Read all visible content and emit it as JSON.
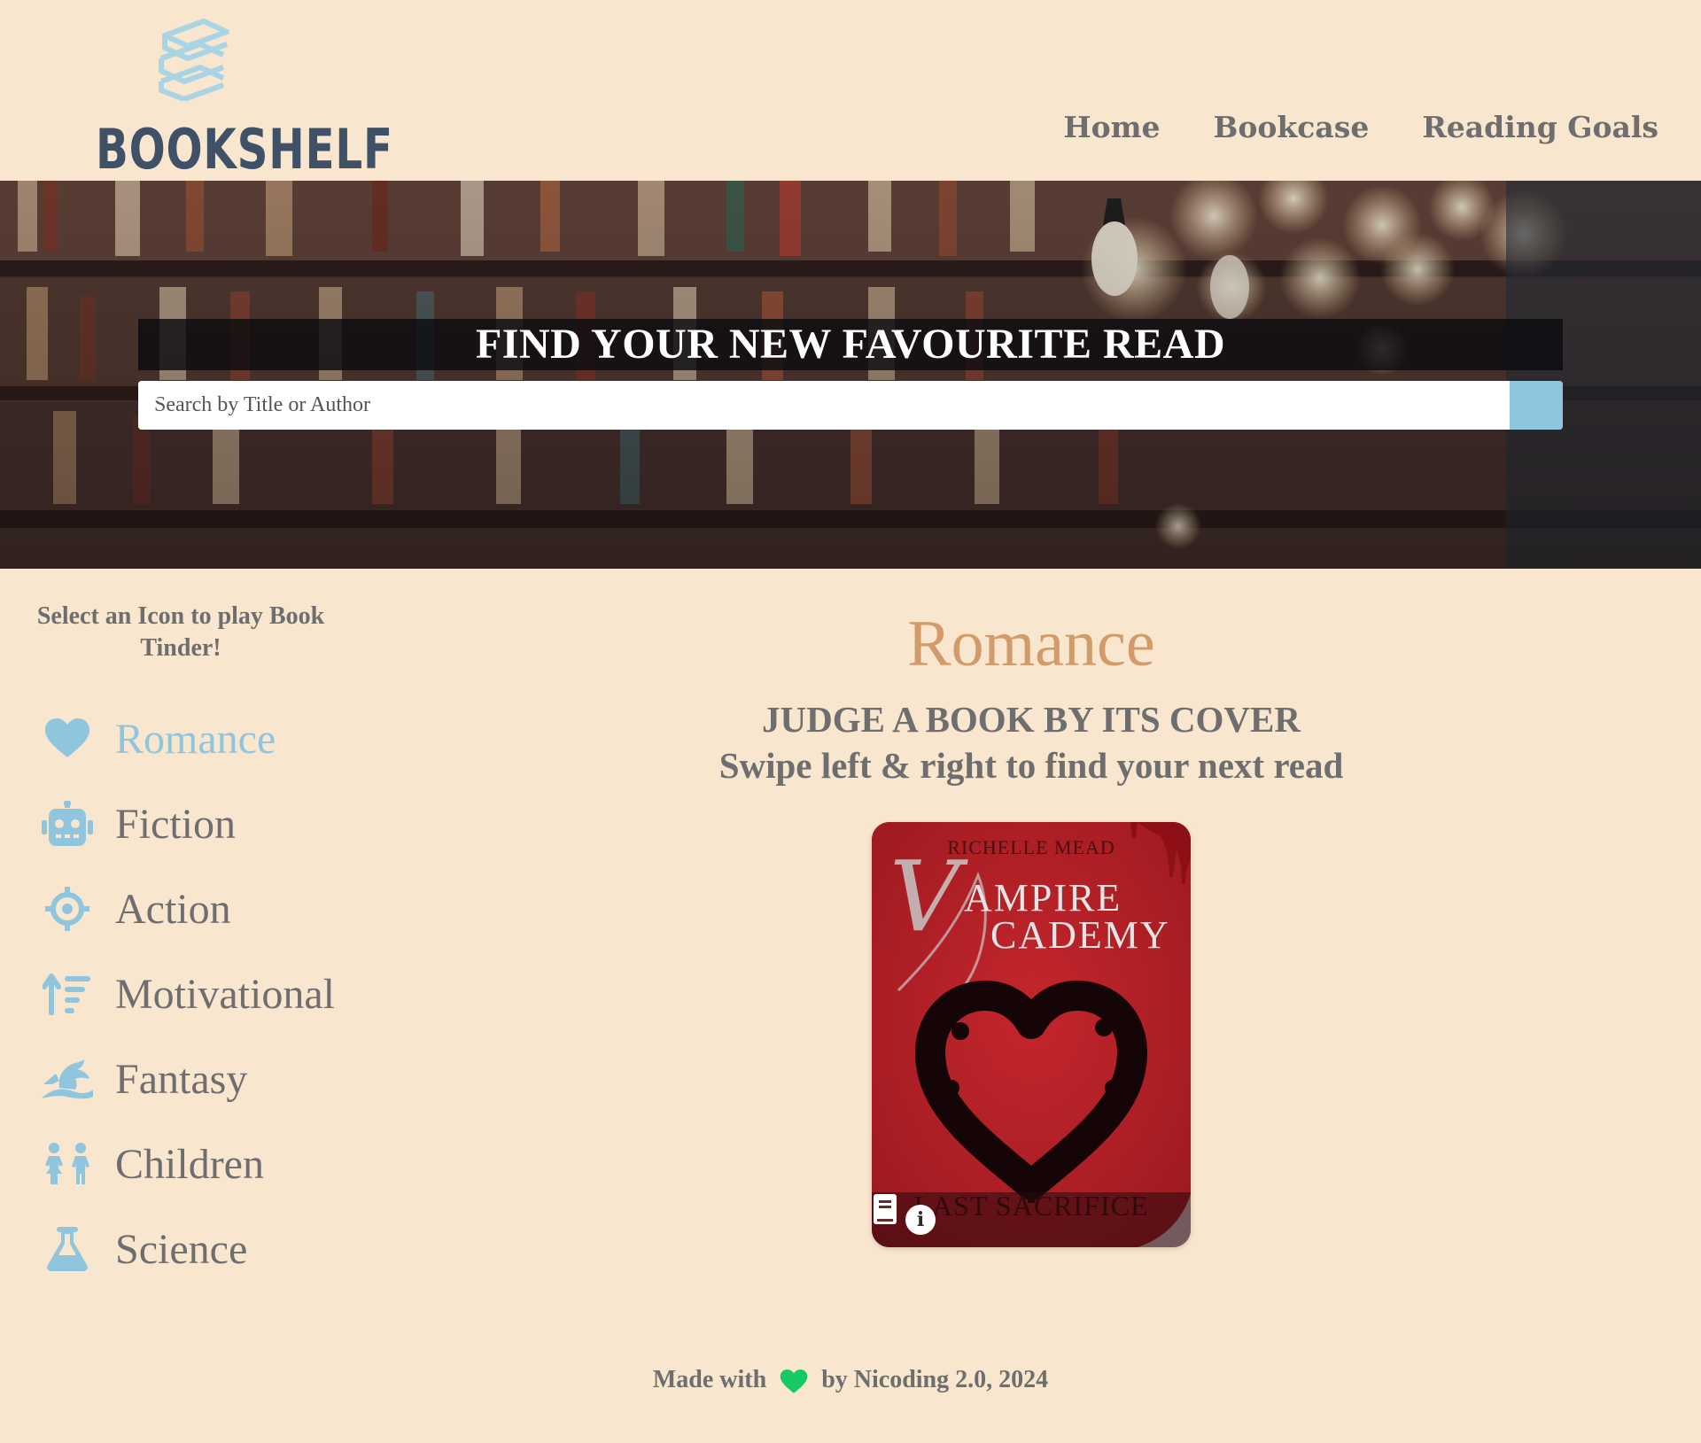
{
  "brand": {
    "name": "BOOKSHELF"
  },
  "nav": {
    "items": [
      {
        "label": "Home"
      },
      {
        "label": "Bookcase"
      },
      {
        "label": "Reading Goals"
      }
    ]
  },
  "hero": {
    "title": "FIND YOUR NEW FAVOURITE READ",
    "search_placeholder": "Search by Title or Author",
    "search_value": ""
  },
  "sidebar": {
    "heading": "Select an Icon to play Book Tinder!",
    "categories": [
      {
        "label": "Romance",
        "icon": "heart-icon",
        "active": true
      },
      {
        "label": "Fiction",
        "icon": "robot-icon",
        "active": false
      },
      {
        "label": "Action",
        "icon": "crosshair-icon",
        "active": false
      },
      {
        "label": "Motivational",
        "icon": "sort-up-icon",
        "active": false
      },
      {
        "label": "Fantasy",
        "icon": "dragon-icon",
        "active": false
      },
      {
        "label": "Children",
        "icon": "children-icon",
        "active": false
      },
      {
        "label": "Science",
        "icon": "flask-icon",
        "active": false
      }
    ]
  },
  "main": {
    "genre": "Romance",
    "tagline_line1": "JUDGE A BOOK BY ITS COVER",
    "tagline_line2": "Swipe left & right to find your next read",
    "book": {
      "author": "RICHELLE MEAD",
      "title_line1": "AMPIRE",
      "title_line2": "CADEMY",
      "title_initial": "V",
      "subtitle": "LAST SACRIFICE"
    }
  },
  "footer": {
    "prefix": "Made with",
    "suffix": "by Nicoding 2.0, 2024"
  },
  "colors": {
    "background": "#f8e6cf",
    "accent": "#8fc6dd",
    "genre_title": "#d39a6a",
    "text": "#6e6e6e",
    "logo_text": "#3f5167",
    "footer_heart": "#17c964",
    "book_cover": "#ad1c22"
  }
}
